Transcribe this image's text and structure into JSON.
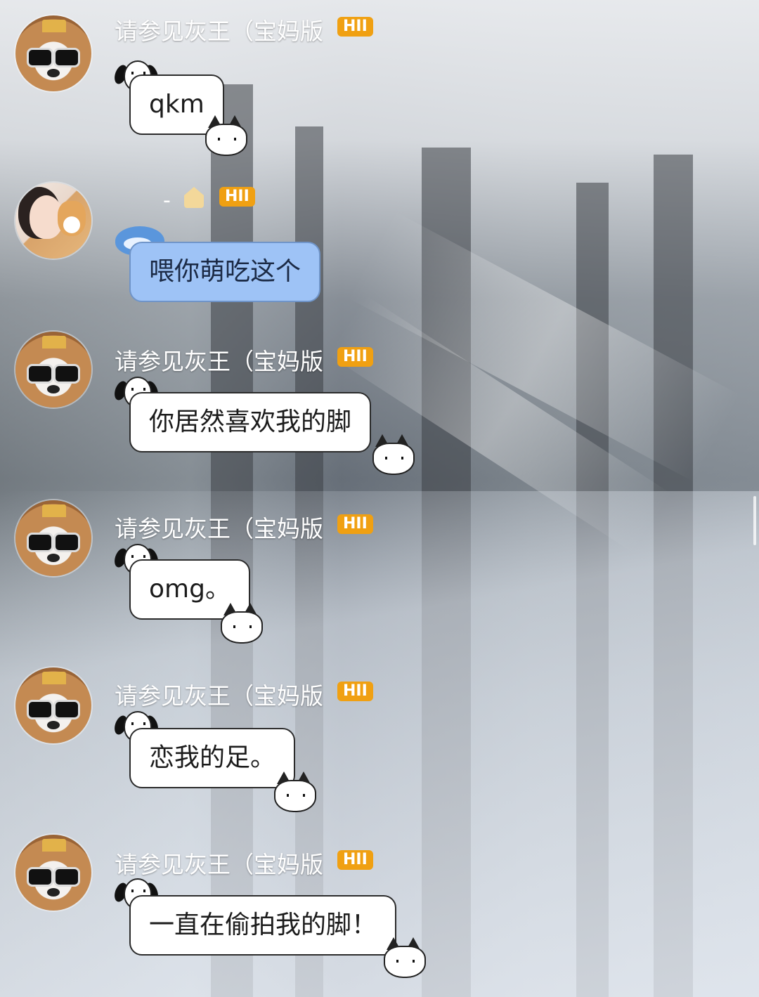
{
  "messages": [
    {
      "sender": "请参见灰王（宝妈版",
      "level_badge": "HII",
      "text": "qkm",
      "avatar": "dog-sunglasses-avatar"
    },
    {
      "sender": "-",
      "level_badge": "HII",
      "text": "喂你萌吃这个",
      "avatar": "girl-with-dog-avatar",
      "bubble_style": "blue"
    },
    {
      "sender": "请参见灰王（宝妈版",
      "level_badge": "HII",
      "text": "你居然喜欢我的脚",
      "avatar": "dog-sunglasses-avatar"
    },
    {
      "sender": "请参见灰王（宝妈版",
      "level_badge": "HII",
      "text": "omg。",
      "avatar": "dog-sunglasses-avatar"
    },
    {
      "sender": "请参见灰王（宝妈版",
      "level_badge": "HII",
      "text": "恋我的足。",
      "avatar": "dog-sunglasses-avatar"
    },
    {
      "sender": "请参见灰王（宝妈版",
      "level_badge": "HII",
      "text": "一直在偷拍我的脚！",
      "avatar": "dog-sunglasses-avatar"
    }
  ],
  "colors": {
    "badge": "#f0a012",
    "bubble_white": "#ffffff",
    "bubble_blue": "#9ec3f6",
    "name_text": "#ffffff"
  }
}
